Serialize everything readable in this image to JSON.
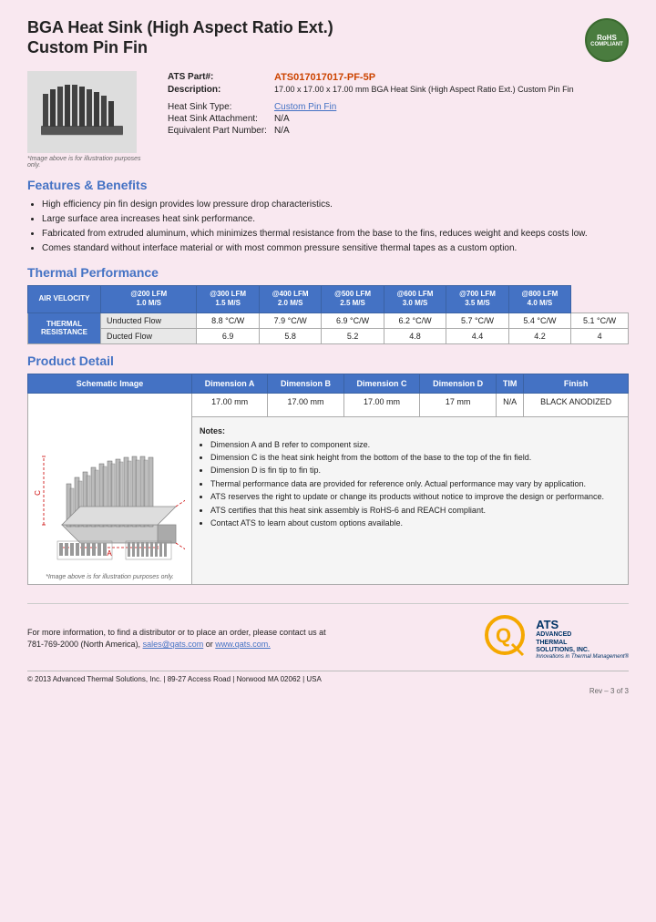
{
  "header": {
    "title_line1": "BGA Heat Sink (High Aspect Ratio Ext.)",
    "title_line2": "Custom Pin Fin",
    "rohs": "RoHS\nCOMPLIANT"
  },
  "product_info": {
    "ats_part_label": "ATS Part#:",
    "ats_part_value": "ATS017017017-PF-5P",
    "description_label": "Description:",
    "description_value": "17.00 x 17.00 x 17.00 mm BGA Heat Sink (High Aspect Ratio Ext.) Custom Pin Fin",
    "heatsink_type_label": "Heat Sink Type:",
    "heatsink_type_value": "Custom Pin Fin",
    "attachment_label": "Heat Sink Attachment:",
    "attachment_value": "N/A",
    "equivalent_label": "Equivalent Part Number:",
    "equivalent_value": "N/A",
    "image_note": "*Image above is for illustration purposes only."
  },
  "features": {
    "section_title": "Features & Benefits",
    "items": [
      "High efficiency pin fin design provides low pressure drop characteristics.",
      "Large surface area increases heat sink performance.",
      "Fabricated from extruded aluminum, which minimizes thermal resistance from the base to the fins, reduces weight and keeps costs low.",
      "Comes standard without interface material or with most common pressure sensitive thermal tapes as a custom option."
    ]
  },
  "thermal_performance": {
    "section_title": "Thermal Performance",
    "header_row": [
      "AIR VELOCITY",
      "@200 LFM\n1.0 M/S",
      "@300 LFM\n1.5 M/S",
      "@400 LFM\n2.0 M/S",
      "@500 LFM\n2.5 M/S",
      "@600 LFM\n3.0 M/S",
      "@700 LFM\n3.5 M/S",
      "@800 LFM\n4.0 M/S"
    ],
    "label": "THERMAL RESISTANCE",
    "rows": [
      {
        "label": "Unducted Flow",
        "values": [
          "8.8 °C/W",
          "7.9 °C/W",
          "6.9 °C/W",
          "6.2 °C/W",
          "5.7 °C/W",
          "5.4 °C/W",
          "5.1 °C/W"
        ]
      },
      {
        "label": "Ducted Flow",
        "values": [
          "6.9",
          "5.8",
          "5.2",
          "4.8",
          "4.4",
          "4.2",
          "4"
        ]
      }
    ]
  },
  "product_detail": {
    "section_title": "Product Detail",
    "columns": [
      "Schematic Image",
      "Dimension A",
      "Dimension B",
      "Dimension C",
      "Dimension D",
      "TIM",
      "Finish"
    ],
    "values": [
      "17.00 mm",
      "17.00 mm",
      "17.00 mm",
      "17 mm",
      "N/A",
      "BLACK ANODIZED"
    ],
    "schematic_note": "*Image above is for illustration purposes only.",
    "notes_title": "Notes:",
    "notes": [
      "Dimension A and B refer to component size.",
      "Dimension C is the heat sink height from the bottom of the base to the top of the fin field.",
      "Dimension D is fin tip to fin tip.",
      "Thermal performance data are provided for reference only. Actual performance may vary by application.",
      "ATS reserves the right to update or change its products without notice to improve the design or performance.",
      "ATS certifies that this heat sink assembly is RoHS-6 and REACH compliant.",
      "Contact ATS to learn about custom options available."
    ]
  },
  "footer": {
    "contact_line1": "For more information, to find a distributor or to place an order, please contact us at",
    "contact_line2": "781-769-2000 (North America),",
    "contact_email": "sales@qats.com",
    "contact_or": " or ",
    "contact_web": "www.qats.com.",
    "copyright": "© 2013 Advanced Thermal Solutions, Inc. | 89-27 Access Road | Norwood MA  02062 | USA",
    "ats_logo_q": "Q",
    "ats_logo_name": "ATS",
    "ats_logo_full": "ADVANCED\nTHERMAL\nSOLUTIONS, INC.",
    "ats_tagline": "Innovations in Thermal Management®",
    "page_num": "Rev – 3 of 3"
  }
}
